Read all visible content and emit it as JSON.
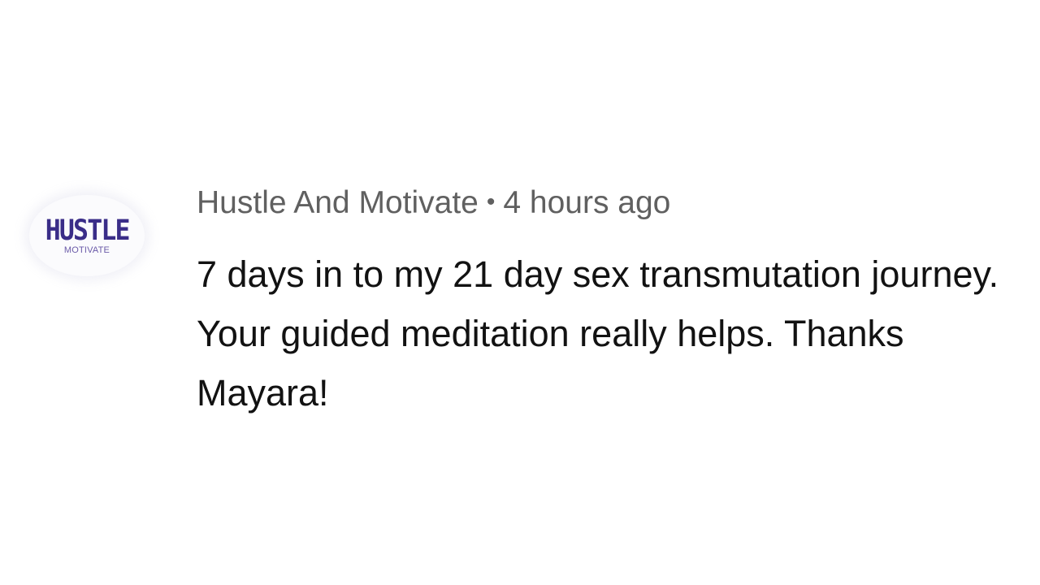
{
  "comment": {
    "author": "Hustle And Motivate",
    "separator": "•",
    "timestamp": "4 hours ago",
    "text": "7 days in to my 21 day sex transmutation journey. Your guided meditation really helps. Thanks Mayara!",
    "avatar": {
      "logo_main": "HUSTLE",
      "logo_sub": "MOTIVATE",
      "brand_color": "#3a2d88"
    }
  },
  "colors": {
    "meta_text": "#606060",
    "body_text": "#121212",
    "background": "#ffffff"
  }
}
